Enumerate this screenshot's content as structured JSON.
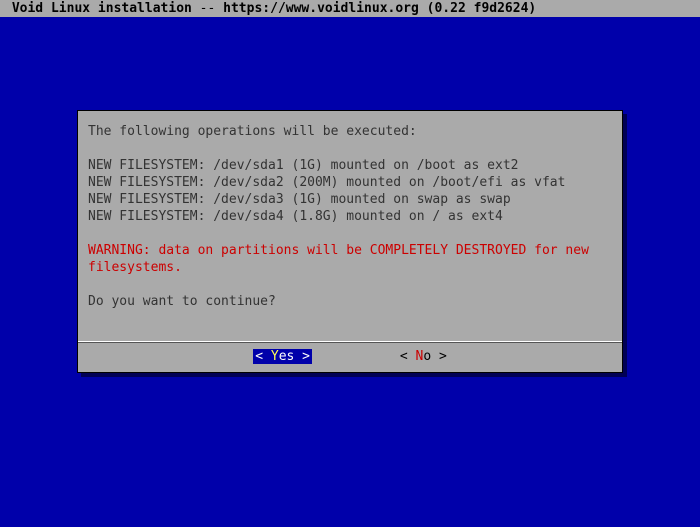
{
  "title": {
    "label": "Void Linux installation",
    "separator": " -- ",
    "url": "https://www.voidlinux.org",
    "version": "(0.22 f9d2624)"
  },
  "dialog": {
    "intro": "The following operations will be executed:",
    "fs_lines": [
      "NEW FILESYSTEM: /dev/sda1 (1G) mounted on /boot as ext2",
      "NEW FILESYSTEM: /dev/sda2 (200M) mounted on /boot/efi as vfat",
      "NEW FILESYSTEM: /dev/sda3 (1G) mounted on swap as swap",
      "NEW FILESYSTEM: /dev/sda4 (1.8G) mounted on / as ext4"
    ],
    "warning": "WARNING: data on partitions will be COMPLETELY DESTROYED for new filesystems.",
    "prompt": "Do you want to continue?"
  },
  "buttons": {
    "yes_label": "Yes",
    "no_label": "No"
  },
  "colors": {
    "background": "#0000aa",
    "panel": "#aaaaaa",
    "warning": "#cc0000",
    "highlight_bg": "#0000aa",
    "highlight_fg": "#ffffff"
  }
}
